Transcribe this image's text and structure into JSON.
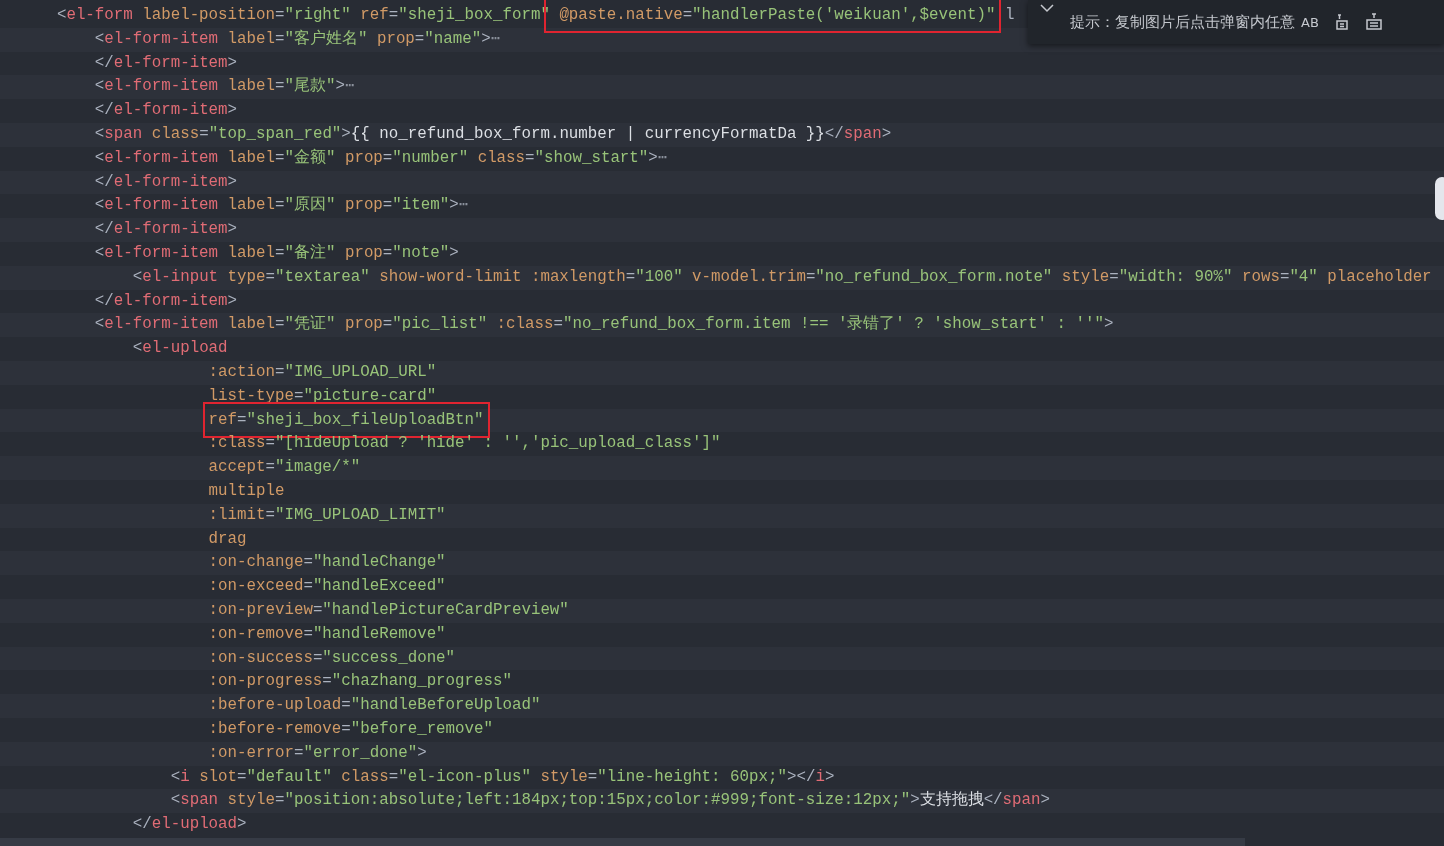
{
  "lines": [
    {
      "segments": [
        {
          "boxed": false,
          "tokens": [
            {
              "kind": "p",
              "text": "    <"
            },
            {
              "kind": "tag",
              "text": "el-form"
            },
            {
              "kind": "attr",
              "text": " label-position"
            },
            {
              "kind": "p",
              "text": "="
            },
            {
              "kind": "str",
              "text": "\"right\""
            },
            {
              "kind": "attr",
              "text": " ref"
            },
            {
              "kind": "p",
              "text": "="
            },
            {
              "kind": "str",
              "text": "\"sheji_box_form\""
            }
          ]
        },
        {
          "boxed": true,
          "tokens": [
            {
              "kind": "attr",
              "text": " @paste.native"
            },
            {
              "kind": "p",
              "text": "="
            },
            {
              "kind": "str",
              "text": "\"handlerPaste('weikuan',$event)\""
            }
          ]
        },
        {
          "boxed": false,
          "tokens": [
            {
              "kind": "p",
              "text": " l"
            }
          ]
        }
      ]
    },
    {
      "segments": [
        {
          "boxed": false,
          "tokens": [
            {
              "kind": "p",
              "text": "        <"
            },
            {
              "kind": "tag",
              "text": "el-form-item"
            },
            {
              "kind": "attr",
              "text": " label"
            },
            {
              "kind": "p",
              "text": "="
            },
            {
              "kind": "str",
              "text": "\"客户姓名\""
            },
            {
              "kind": "attr",
              "text": " prop"
            },
            {
              "kind": "p",
              "text": "="
            },
            {
              "kind": "str",
              "text": "\"name\""
            },
            {
              "kind": "p",
              "text": ">"
            },
            {
              "kind": "fold",
              "text": "⋯"
            }
          ]
        }
      ]
    },
    {
      "segments": [
        {
          "boxed": false,
          "tokens": [
            {
              "kind": "p",
              "text": "        </"
            },
            {
              "kind": "tag",
              "text": "el-form-item"
            },
            {
              "kind": "p",
              "text": ">"
            }
          ]
        }
      ]
    },
    {
      "segments": [
        {
          "boxed": false,
          "tokens": [
            {
              "kind": "p",
              "text": "        <"
            },
            {
              "kind": "tag",
              "text": "el-form-item"
            },
            {
              "kind": "attr",
              "text": " label"
            },
            {
              "kind": "p",
              "text": "="
            },
            {
              "kind": "str",
              "text": "\"尾款\""
            },
            {
              "kind": "p",
              "text": ">"
            },
            {
              "kind": "fold",
              "text": "⋯"
            }
          ]
        }
      ]
    },
    {
      "segments": [
        {
          "boxed": false,
          "tokens": [
            {
              "kind": "p",
              "text": "        </"
            },
            {
              "kind": "tag",
              "text": "el-form-item"
            },
            {
              "kind": "p",
              "text": ">"
            }
          ]
        }
      ]
    },
    {
      "segments": [
        {
          "boxed": false,
          "tokens": [
            {
              "kind": "p",
              "text": "        <"
            },
            {
              "kind": "tag",
              "text": "span"
            },
            {
              "kind": "attr",
              "text": " class"
            },
            {
              "kind": "p",
              "text": "="
            },
            {
              "kind": "str",
              "text": "\"top_span_red\""
            },
            {
              "kind": "p",
              "text": ">"
            },
            {
              "kind": "txt",
              "text": "{{ no_refund_box_form.number | currencyFormatDa }}"
            },
            {
              "kind": "p",
              "text": "</"
            },
            {
              "kind": "tag",
              "text": "span"
            },
            {
              "kind": "p",
              "text": ">"
            }
          ]
        }
      ]
    },
    {
      "segments": [
        {
          "boxed": false,
          "tokens": [
            {
              "kind": "p",
              "text": "        <"
            },
            {
              "kind": "tag",
              "text": "el-form-item"
            },
            {
              "kind": "attr",
              "text": " label"
            },
            {
              "kind": "p",
              "text": "="
            },
            {
              "kind": "str",
              "text": "\"金额\""
            },
            {
              "kind": "attr",
              "text": " prop"
            },
            {
              "kind": "p",
              "text": "="
            },
            {
              "kind": "str",
              "text": "\"number\""
            },
            {
              "kind": "attr",
              "text": " class"
            },
            {
              "kind": "p",
              "text": "="
            },
            {
              "kind": "str",
              "text": "\"show_start\""
            },
            {
              "kind": "p",
              "text": ">"
            },
            {
              "kind": "fold",
              "text": "⋯"
            }
          ]
        }
      ]
    },
    {
      "segments": [
        {
          "boxed": false,
          "tokens": [
            {
              "kind": "p",
              "text": "        </"
            },
            {
              "kind": "tag",
              "text": "el-form-item"
            },
            {
              "kind": "p",
              "text": ">"
            }
          ]
        }
      ]
    },
    {
      "segments": [
        {
          "boxed": false,
          "tokens": [
            {
              "kind": "p",
              "text": "        <"
            },
            {
              "kind": "tag",
              "text": "el-form-item"
            },
            {
              "kind": "attr",
              "text": " label"
            },
            {
              "kind": "p",
              "text": "="
            },
            {
              "kind": "str",
              "text": "\"原因\""
            },
            {
              "kind": "attr",
              "text": " prop"
            },
            {
              "kind": "p",
              "text": "="
            },
            {
              "kind": "str",
              "text": "\"item\""
            },
            {
              "kind": "p",
              "text": ">"
            },
            {
              "kind": "fold",
              "text": "⋯"
            }
          ]
        }
      ]
    },
    {
      "segments": [
        {
          "boxed": false,
          "tokens": [
            {
              "kind": "p",
              "text": "        </"
            },
            {
              "kind": "tag",
              "text": "el-form-item"
            },
            {
              "kind": "p",
              "text": ">"
            }
          ]
        }
      ]
    },
    {
      "segments": [
        {
          "boxed": false,
          "tokens": [
            {
              "kind": "p",
              "text": "        <"
            },
            {
              "kind": "tag",
              "text": "el-form-item"
            },
            {
              "kind": "attr",
              "text": " label"
            },
            {
              "kind": "p",
              "text": "="
            },
            {
              "kind": "str",
              "text": "\"备注\""
            },
            {
              "kind": "attr",
              "text": " prop"
            },
            {
              "kind": "p",
              "text": "="
            },
            {
              "kind": "str",
              "text": "\"note\""
            },
            {
              "kind": "p",
              "text": ">"
            }
          ]
        }
      ]
    },
    {
      "segments": [
        {
          "boxed": false,
          "tokens": [
            {
              "kind": "p",
              "text": "            <"
            },
            {
              "kind": "tag",
              "text": "el-input"
            },
            {
              "kind": "attr",
              "text": " type"
            },
            {
              "kind": "p",
              "text": "="
            },
            {
              "kind": "str",
              "text": "\"textarea\""
            },
            {
              "kind": "attr",
              "text": " show-word-limit :maxlength"
            },
            {
              "kind": "p",
              "text": "="
            },
            {
              "kind": "str",
              "text": "\"100\""
            },
            {
              "kind": "attr",
              "text": " v-model.trim"
            },
            {
              "kind": "p",
              "text": "="
            },
            {
              "kind": "str",
              "text": "\"no_refund_box_form.note\""
            },
            {
              "kind": "attr",
              "text": " style"
            },
            {
              "kind": "p",
              "text": "="
            },
            {
              "kind": "str",
              "text": "\"width: 90%\""
            },
            {
              "kind": "attr",
              "text": " rows"
            },
            {
              "kind": "p",
              "text": "="
            },
            {
              "kind": "str",
              "text": "\"4\""
            },
            {
              "kind": "attr",
              "text": " placeholder"
            }
          ]
        }
      ]
    },
    {
      "segments": [
        {
          "boxed": false,
          "tokens": [
            {
              "kind": "p",
              "text": "        </"
            },
            {
              "kind": "tag",
              "text": "el-form-item"
            },
            {
              "kind": "p",
              "text": ">"
            }
          ]
        }
      ]
    },
    {
      "segments": [
        {
          "boxed": false,
          "tokens": [
            {
              "kind": "p",
              "text": "        <"
            },
            {
              "kind": "tag",
              "text": "el-form-item"
            },
            {
              "kind": "attr",
              "text": " label"
            },
            {
              "kind": "p",
              "text": "="
            },
            {
              "kind": "str",
              "text": "\"凭证\""
            },
            {
              "kind": "attr",
              "text": " prop"
            },
            {
              "kind": "p",
              "text": "="
            },
            {
              "kind": "str",
              "text": "\"pic_list\""
            },
            {
              "kind": "attr",
              "text": " :class"
            },
            {
              "kind": "p",
              "text": "="
            },
            {
              "kind": "str",
              "text": "\"no_refund_box_form.item !== '录错了' ? 'show_start' : ''\""
            },
            {
              "kind": "p",
              "text": ">"
            }
          ]
        }
      ]
    },
    {
      "segments": [
        {
          "boxed": false,
          "tokens": [
            {
              "kind": "p",
              "text": "            <"
            },
            {
              "kind": "tag",
              "text": "el-upload"
            }
          ]
        }
      ]
    },
    {
      "segments": [
        {
          "boxed": false,
          "tokens": [
            {
              "kind": "attr",
              "text": "                    :action"
            },
            {
              "kind": "p",
              "text": "="
            },
            {
              "kind": "str",
              "text": "\"IMG_UPLOAD_URL\""
            }
          ]
        }
      ]
    },
    {
      "segments": [
        {
          "boxed": false,
          "tokens": [
            {
              "kind": "attr",
              "text": "                    list-type"
            },
            {
              "kind": "p",
              "text": "="
            },
            {
              "kind": "str",
              "text": "\"picture-card\""
            }
          ]
        }
      ]
    },
    {
      "segments": [
        {
          "boxed": true,
          "tokens": [
            {
              "kind": "attr",
              "text": "                    ref"
            },
            {
              "kind": "p",
              "text": "="
            },
            {
              "kind": "str",
              "text": "\"sheji_box_fileUploadBtn\""
            }
          ]
        }
      ]
    },
    {
      "segments": [
        {
          "boxed": false,
          "tokens": [
            {
              "kind": "attr",
              "text": "                    :class"
            },
            {
              "kind": "p",
              "text": "="
            },
            {
              "kind": "str",
              "text": "\"[hideUpload ? 'hide' : '','pic_upload_class']\""
            }
          ]
        }
      ]
    },
    {
      "segments": [
        {
          "boxed": false,
          "tokens": [
            {
              "kind": "attr",
              "text": "                    accept"
            },
            {
              "kind": "p",
              "text": "="
            },
            {
              "kind": "str",
              "text": "\"image/*\""
            }
          ]
        }
      ]
    },
    {
      "segments": [
        {
          "boxed": false,
          "tokens": [
            {
              "kind": "attr",
              "text": "                    multiple"
            }
          ]
        }
      ]
    },
    {
      "segments": [
        {
          "boxed": false,
          "tokens": [
            {
              "kind": "attr",
              "text": "                    :limit"
            },
            {
              "kind": "p",
              "text": "="
            },
            {
              "kind": "str",
              "text": "\"IMG_UPLOAD_LIMIT\""
            }
          ]
        }
      ]
    },
    {
      "segments": [
        {
          "boxed": false,
          "tokens": [
            {
              "kind": "attr",
              "text": "                    drag"
            }
          ]
        }
      ]
    },
    {
      "segments": [
        {
          "boxed": false,
          "tokens": [
            {
              "kind": "attr",
              "text": "                    :on-change"
            },
            {
              "kind": "p",
              "text": "="
            },
            {
              "kind": "str",
              "text": "\"handleChange\""
            }
          ]
        }
      ]
    },
    {
      "segments": [
        {
          "boxed": false,
          "tokens": [
            {
              "kind": "attr",
              "text": "                    :on-exceed"
            },
            {
              "kind": "p",
              "text": "="
            },
            {
              "kind": "str",
              "text": "\"handleExceed\""
            }
          ]
        }
      ]
    },
    {
      "segments": [
        {
          "boxed": false,
          "tokens": [
            {
              "kind": "attr",
              "text": "                    :on-preview"
            },
            {
              "kind": "p",
              "text": "="
            },
            {
              "kind": "str",
              "text": "\"handlePictureCardPreview\""
            }
          ]
        }
      ]
    },
    {
      "segments": [
        {
          "boxed": false,
          "tokens": [
            {
              "kind": "attr",
              "text": "                    :on-remove"
            },
            {
              "kind": "p",
              "text": "="
            },
            {
              "kind": "str",
              "text": "\"handleRemove\""
            }
          ]
        }
      ]
    },
    {
      "segments": [
        {
          "boxed": false,
          "tokens": [
            {
              "kind": "attr",
              "text": "                    :on-success"
            },
            {
              "kind": "p",
              "text": "="
            },
            {
              "kind": "str",
              "text": "\"success_done\""
            }
          ]
        }
      ]
    },
    {
      "segments": [
        {
          "boxed": false,
          "tokens": [
            {
              "kind": "attr",
              "text": "                    :on-progress"
            },
            {
              "kind": "p",
              "text": "="
            },
            {
              "kind": "str",
              "text": "\"chazhang_progress\""
            }
          ]
        }
      ]
    },
    {
      "segments": [
        {
          "boxed": false,
          "tokens": [
            {
              "kind": "attr",
              "text": "                    :before-upload"
            },
            {
              "kind": "p",
              "text": "="
            },
            {
              "kind": "str",
              "text": "\"handleBeforeUpload\""
            }
          ]
        }
      ]
    },
    {
      "segments": [
        {
          "boxed": false,
          "tokens": [
            {
              "kind": "attr",
              "text": "                    :before-remove"
            },
            {
              "kind": "p",
              "text": "="
            },
            {
              "kind": "str",
              "text": "\"before_remove\""
            }
          ]
        }
      ]
    },
    {
      "segments": [
        {
          "boxed": false,
          "tokens": [
            {
              "kind": "attr",
              "text": "                    :on-error"
            },
            {
              "kind": "p",
              "text": "="
            },
            {
              "kind": "str",
              "text": "\"error_done\""
            },
            {
              "kind": "p",
              "text": ">"
            }
          ]
        }
      ]
    },
    {
      "segments": [
        {
          "boxed": false,
          "tokens": [
            {
              "kind": "p",
              "text": "                <"
            },
            {
              "kind": "tag",
              "text": "i"
            },
            {
              "kind": "attr",
              "text": " slot"
            },
            {
              "kind": "p",
              "text": "="
            },
            {
              "kind": "str",
              "text": "\"default\""
            },
            {
              "kind": "attr",
              "text": " class"
            },
            {
              "kind": "p",
              "text": "="
            },
            {
              "kind": "str",
              "text": "\"el-icon-plus\""
            },
            {
              "kind": "attr",
              "text": " style"
            },
            {
              "kind": "p",
              "text": "="
            },
            {
              "kind": "str",
              "text": "\"line-height: 60px;\""
            },
            {
              "kind": "p",
              "text": "></"
            },
            {
              "kind": "tag",
              "text": "i"
            },
            {
              "kind": "p",
              "text": ">"
            }
          ]
        }
      ]
    },
    {
      "segments": [
        {
          "boxed": false,
          "tokens": [
            {
              "kind": "p",
              "text": "                <"
            },
            {
              "kind": "tag",
              "text": "span"
            },
            {
              "kind": "attr",
              "text": " style"
            },
            {
              "kind": "p",
              "text": "="
            },
            {
              "kind": "str",
              "text": "\"position:absolute;left:184px;top:15px;color:#999;font-size:12px;\""
            },
            {
              "kind": "p",
              "text": ">"
            },
            {
              "kind": "txt",
              "text": "支持拖拽"
            },
            {
              "kind": "p",
              "text": "</"
            },
            {
              "kind": "tag",
              "text": "span"
            },
            {
              "kind": "p",
              "text": ">"
            }
          ]
        }
      ]
    },
    {
      "segments": [
        {
          "boxed": false,
          "tokens": [
            {
              "kind": "p",
              "text": "            </"
            },
            {
              "kind": "tag",
              "text": "el-upload"
            },
            {
              "kind": "p",
              "text": ">"
            }
          ]
        }
      ]
    }
  ],
  "find_widget": {
    "value": "提示：复制图片后点击弹窗内任意",
    "toggle": "AB"
  }
}
